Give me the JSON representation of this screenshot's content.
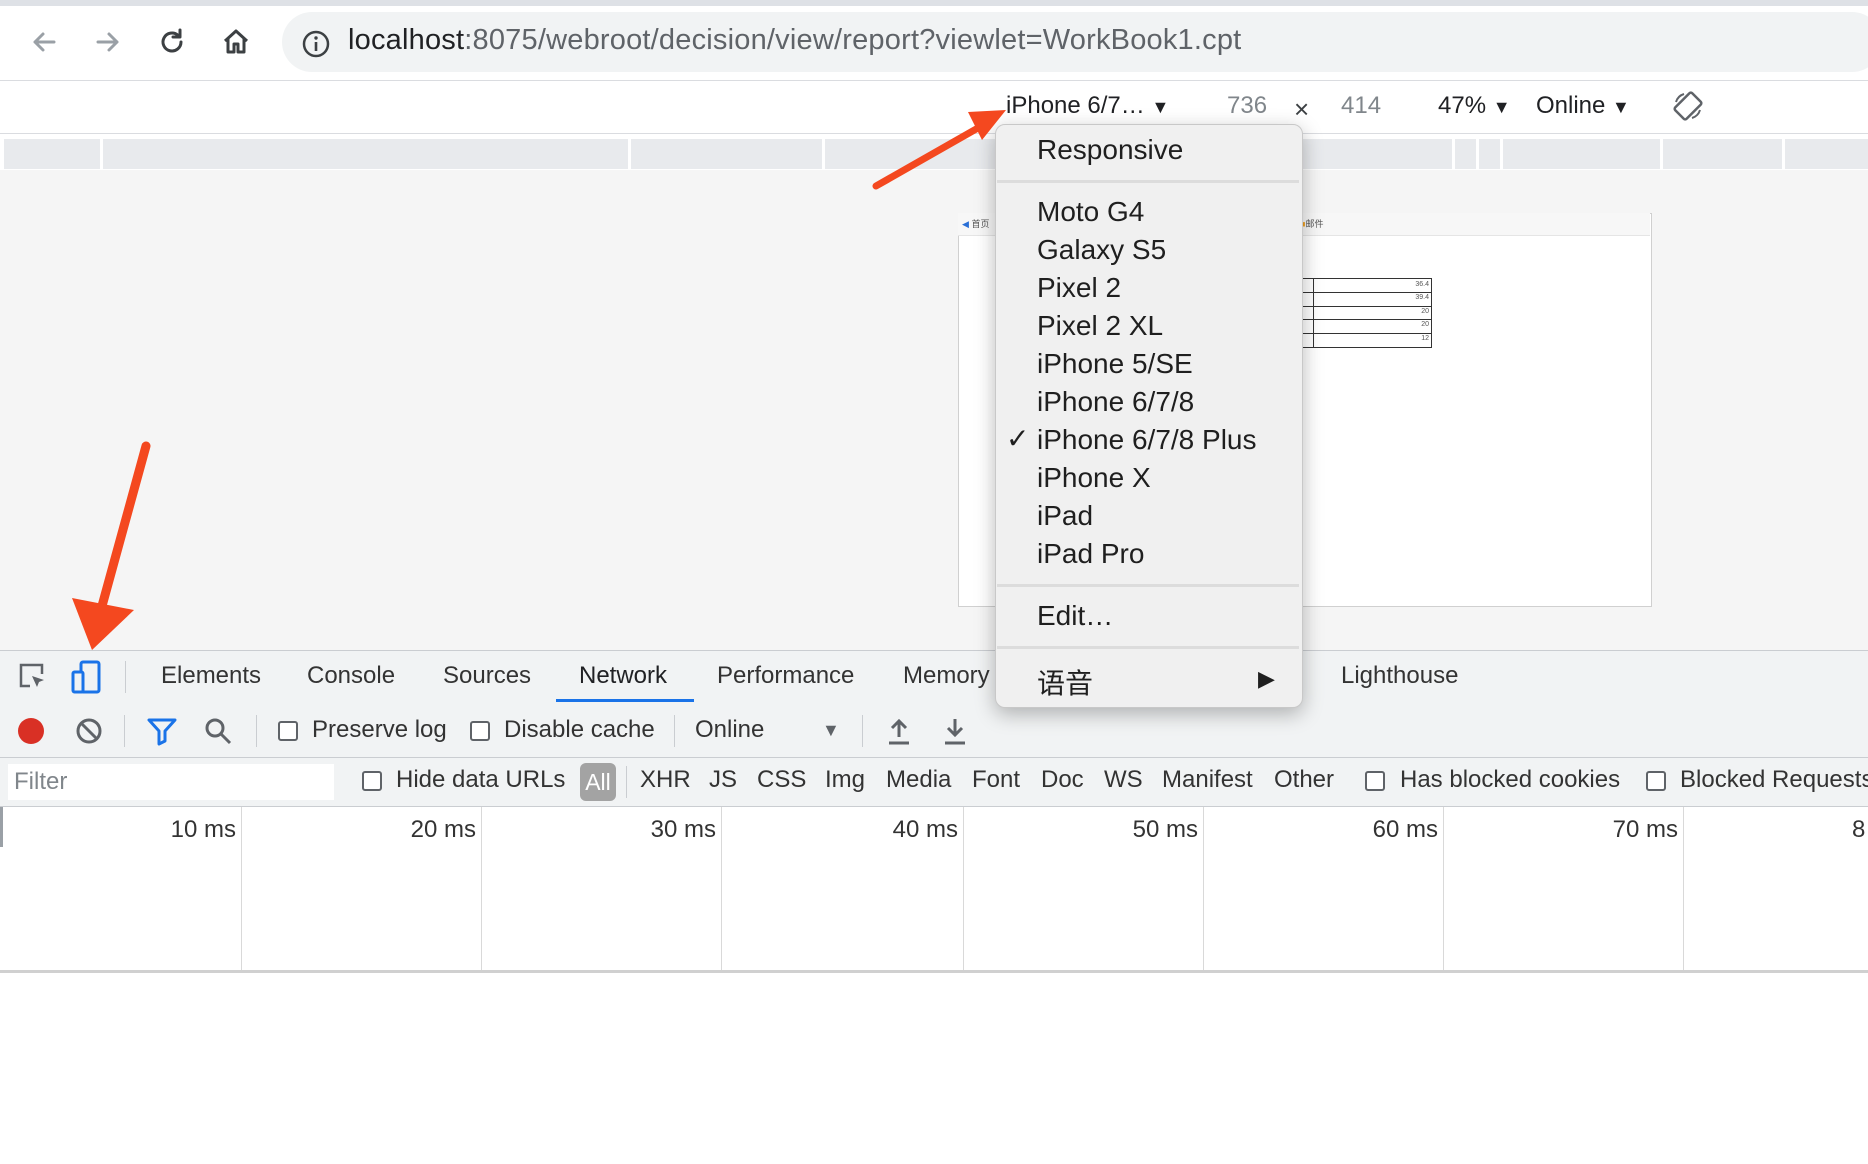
{
  "browser": {
    "url_host": "localhost",
    "url_rest": ":8075/webroot/decision/view/report?viewlet=WorkBook1.cpt"
  },
  "device_toolbar": {
    "device_name": "iPhone 6/7…",
    "width": "736",
    "times": "×",
    "height": "414",
    "zoom": "47%",
    "throttle": "Online"
  },
  "page_preview": {
    "header_left": "首页",
    "header_right": "邮件",
    "cells": [
      "36.4",
      "39.4",
      "20",
      "20",
      "12"
    ]
  },
  "device_menu": {
    "responsive": "Responsive",
    "devices": [
      "Moto G4",
      "Galaxy S5",
      "Pixel 2",
      "Pixel 2 XL",
      "iPhone 5/SE",
      "iPhone 6/7/8",
      "iPhone 6/7/8 Plus",
      "iPhone X",
      "iPad",
      "iPad Pro"
    ],
    "selected": "iPhone 6/7/8 Plus",
    "checkmark": "✓",
    "edit": "Edit…",
    "language": "语音",
    "submenu_arrow": "▶"
  },
  "devtools": {
    "tabs": [
      "Elements",
      "Console",
      "Sources",
      "Network",
      "Performance",
      "Memory",
      "Lighthouse"
    ],
    "active_tab": "Network",
    "network_toolbar": {
      "preserve_log": "Preserve log",
      "disable_cache": "Disable cache",
      "throttle": "Online"
    },
    "filter_bar": {
      "filter_placeholder": "Filter",
      "hide_data_urls": "Hide data URLs",
      "types": [
        "All",
        "XHR",
        "JS",
        "CSS",
        "Img",
        "Media",
        "Font",
        "Doc",
        "WS",
        "Manifest",
        "Other"
      ],
      "has_blocked_cookies": "Has blocked cookies",
      "blocked_requests": "Blocked Requests"
    },
    "timeline_labels": [
      "10 ms",
      "20 ms",
      "30 ms",
      "40 ms",
      "50 ms",
      "60 ms",
      "70 ms",
      "8"
    ]
  },
  "colors": {
    "accent": "#1a73e8",
    "record": "#d93025",
    "annotation_arrow": "#f4481f"
  }
}
